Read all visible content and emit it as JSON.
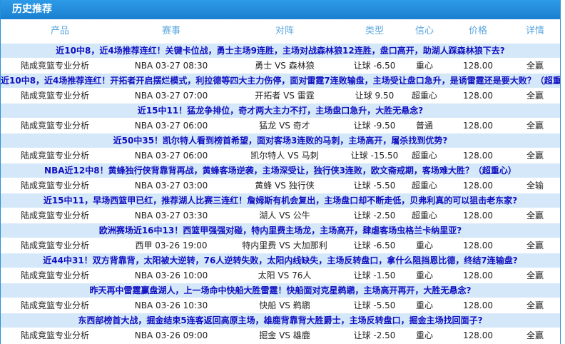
{
  "panel": {
    "title": "历史推荐"
  },
  "columns": [
    "产品",
    "赛事",
    "对阵",
    "类型",
    "信心",
    "价格",
    "详情"
  ],
  "items": [
    {
      "headline": "近10中8，近4场推荐连红！关键卡位战，勇士主场9连胜，主场对战森林狼12连胜，盘口高开，助湖人踩森林狼下去?",
      "product": "陆成竞篮专业分析",
      "event": "NBA 03-27 08:30",
      "match": "勇士 VS 森林狼",
      "type": "让球 -6.50",
      "confidence": "重心",
      "price": "128.00",
      "detail": "全赢"
    },
    {
      "headline": "近10中8，近4场推荐连红！开拓者开启摆烂模式，利拉德等四大主力伤停，面对雷霆7连败输盘，主场受让盘口急升，是诱雷霆还是要大败？（超重心）",
      "product": "陆成竞篮专业分析",
      "event": "NBA 03-27 07:00",
      "match": "开拓者 VS 雷霆",
      "type": "让球 9.50",
      "confidence": "超重心",
      "price": "128.00",
      "detail": "全赢"
    },
    {
      "headline": "近15中11！猛龙争排位，奇才两大主力不打，主场盘口急升，大胜无悬念?",
      "product": "陆成竞篮专业分析",
      "event": "NBA 03-27 06:00",
      "match": "猛龙 VS 奇才",
      "type": "让球 -9.50",
      "confidence": "普通",
      "price": "128.00",
      "detail": "全赢"
    },
    {
      "headline": "近50中35！凯尔特人看到榜首希望，面对客场3连败的马刺，主场高开，屠杀找到优势?",
      "product": "陆成竞篮专业分析",
      "event": "NBA 03-27 06:00",
      "match": "凯尔特人 VS 马刺",
      "type": "让球 -15.50",
      "confidence": "超重心",
      "price": "128.00",
      "detail": "全赢"
    },
    {
      "headline": "NBA近12中8！黄蜂独行侠背靠背再战，黄蜂客场逆袭，主场深受让，独行侠3连败，欧文斋戒期，客场难大胜？（超重心）",
      "product": "陆成竞篮专业分析",
      "event": "NBA 03-27 03:00",
      "match": "黄蜂 VS 独行侠",
      "type": "让球 -5.50",
      "confidence": "超重心",
      "price": "128.00",
      "detail": "全输"
    },
    {
      "headline": "近15中11，早场西篮甲已红，推荐湖人比赛三连红！詹姆斯有机会复出，主场盘口却不断走低，贝弗利真的可以狙击老东家?",
      "product": "陆成竞篮专业分析",
      "event": "NBA 03-27 03:30",
      "match": "湖人 VS 公牛",
      "type": "让球 -2.50",
      "confidence": "超重心",
      "price": "128.00",
      "detail": "全赢"
    },
    {
      "headline": "欧洲赛场近16中13！西篮甲强强对碰，特内里费主场龙，主场高开，肆虐客场虫格兰卡纳里亚?",
      "product": "陆成竞篮专业分析",
      "event": "西甲 03-26 19:00",
      "match": "特内里费 VS 大加那利",
      "type": "让球 -6.50",
      "confidence": "重心",
      "price": "128.00",
      "detail": "全赢"
    },
    {
      "headline": "近44中31！双方背靠背，太阳被大逆转，76人逆转失败，太阳内线缺失，主场反转盘口，拿什么阻挡恩比德，终结7连输盘?",
      "product": "陆成竞篮专业分析",
      "event": "NBA 03-26 10:00",
      "match": "太阳 VS 76人",
      "type": "让球 -1.50",
      "confidence": "重心",
      "price": "128.00",
      "detail": "全赢"
    },
    {
      "headline": "昨天再中雷霆赢盘湖人，上一场命中快船大胜雷霆！快船面对克星鹈鹕，主场高开再开，大胜无悬念?",
      "product": "陆成竞篮专业分析",
      "event": "NBA 03-26 10:30",
      "match": "快船 VS 鹈鹕",
      "type": "让球 -5.50",
      "confidence": "重心",
      "price": "128.00",
      "detail": "全赢"
    },
    {
      "headline": "东西部榜首大战，掘金结束5连客返回高原主场，雄鹿背靠背大胜爵士，主场反转盘口，掘金主场找回面子?",
      "product": "陆成竞篮专业分析",
      "event": "NBA 03-26 09:00",
      "match": "掘金 VS 雄鹿",
      "type": "让球 -2.50",
      "confidence": "重心",
      "price": "128.00",
      "detail": "全赢"
    }
  ]
}
